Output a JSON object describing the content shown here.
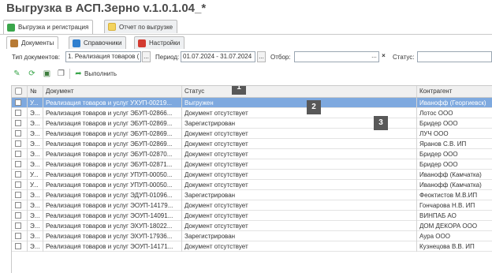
{
  "window": {
    "title": "Выгрузка в АСП.Зерно v.1.0.1.04_*"
  },
  "top_tabs": [
    {
      "label": "Выгрузка и регистрация",
      "icon": "upload-register-icon"
    },
    {
      "label": "Отчет по выгрузке",
      "icon": "report-icon"
    }
  ],
  "sub_tabs": [
    {
      "label": "Документы",
      "icon": "documents-icon"
    },
    {
      "label": "Справочники",
      "icon": "catalogs-icon"
    },
    {
      "label": "Настройки",
      "icon": "settings-icon"
    }
  ],
  "filters": {
    "doc_type_label": "Тип документов:",
    "doc_type_value": "1. Реализация товаров (",
    "period_label": "Период:",
    "period_value": "01.07.2024 - 31.07.2024",
    "selection_label": "Отбор:",
    "selection_value": "",
    "status_label": "Статус:",
    "status_value": "",
    "ellipsis": "...",
    "clear": "×"
  },
  "toolbar": {
    "execute_label": "Выполнить"
  },
  "grid": {
    "columns": [
      "№",
      "Документ",
      "Статус",
      "Контрагент"
    ],
    "rows": [
      {
        "num": "У...",
        "doc": "Реализация товаров и услуг УХУП-00219...",
        "status": "Выгружен",
        "contractor": "Иванофф (Георгиевск)",
        "selected": true
      },
      {
        "num": "Э...",
        "doc": "Реализация товаров и услуг ЭБУП-02866...",
        "status": "Документ отсутствует",
        "contractor": "Лотос ООО"
      },
      {
        "num": "Э...",
        "doc": "Реализация товаров и услуг ЭБУП-02869...",
        "status": "Зарегистрирован",
        "contractor": "Бридер ООО"
      },
      {
        "num": "Э...",
        "doc": "Реализация товаров и услуг ЭБУП-02869...",
        "status": "Документ отсутствует",
        "contractor": "ЛУЧ ООО"
      },
      {
        "num": "Э...",
        "doc": "Реализация товаров и услуг ЭБУП-02869...",
        "status": "Документ отсутствует",
        "contractor": "Яранов С.В. ИП"
      },
      {
        "num": "Э...",
        "doc": "Реализация товаров и услуг ЭБУП-02870...",
        "status": "Документ отсутствует",
        "contractor": "Бридер ООО"
      },
      {
        "num": "Э...",
        "doc": "Реализация товаров и услуг ЭБУП-02871...",
        "status": "Документ отсутствует",
        "contractor": "Бридер ООО"
      },
      {
        "num": "У...",
        "doc": "Реализация товаров и услуг УПУП-00050...",
        "status": "Документ отсутствует",
        "contractor": "Иванофф (Камчатка)"
      },
      {
        "num": "У...",
        "doc": "Реализация товаров и услуг УПУП-00050...",
        "status": "Документ отсутствует",
        "contractor": "Иванофф (Камчатка)"
      },
      {
        "num": "Э...",
        "doc": "Реализация товаров и услуг ЭДУП-01096...",
        "status": "Зарегистрирован",
        "contractor": "Феоктистов М.В.ИП"
      },
      {
        "num": "Э...",
        "doc": "Реализация товаров и услуг ЭОУП-14179...",
        "status": "Документ отсутствует",
        "contractor": "Гончарова Н.В. ИП"
      },
      {
        "num": "Э...",
        "doc": "Реализация товаров и услуг ЭОУП-14091...",
        "status": "Документ отсутствует",
        "contractor": "ВИНПАБ АО"
      },
      {
        "num": "Э...",
        "doc": "Реализация товаров и услуг ЭХУП-18022...",
        "status": "Документ отсутствует",
        "contractor": "ДОМ ДЕКОРА ООО"
      },
      {
        "num": "Э...",
        "doc": "Реализация товаров и услуг ЭХУП-17936...",
        "status": "Зарегистрирован",
        "contractor": "Аура ООО"
      },
      {
        "num": "Э...",
        "doc": "Реализация товаров и услуг ЭОУП-14171...",
        "status": "Документ отсутствует",
        "contractor": "Кузнецова В.В. ИП"
      }
    ]
  },
  "markers": [
    "1",
    "2",
    "3"
  ],
  "colors": {
    "selected_row": "#7ea9df",
    "marker_bg": "#585858",
    "header_bg": "#f0f0f0"
  }
}
